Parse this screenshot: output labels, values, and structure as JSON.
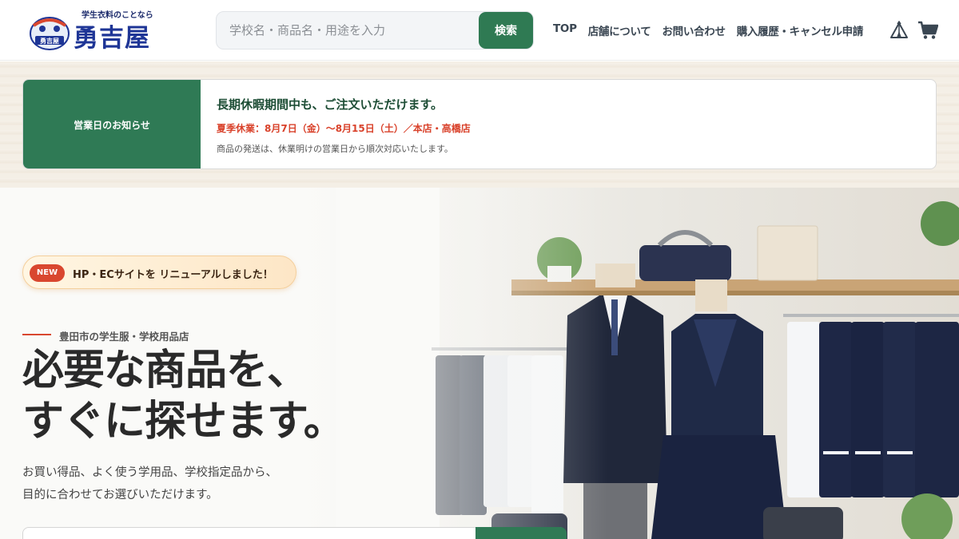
{
  "header": {
    "logo": {
      "tagline": "学生衣料のことなら",
      "name": "勇吉屋",
      "badge_text": "勇吉屋"
    },
    "search": {
      "placeholder": "学校名・商品名・用途を入力",
      "button_label": "検索"
    },
    "nav": [
      {
        "label": "TOP"
      },
      {
        "label": "店舗について"
      },
      {
        "label": "お問い合わせ"
      },
      {
        "label": "購入履歴・キャンセル申請"
      }
    ],
    "icons": [
      "tent-icon",
      "cart-icon"
    ]
  },
  "notice": {
    "label": "営業日のお知らせ",
    "title": "長期休暇期間中も、ご注文いただけます。",
    "holiday": "夏季休業：8月7日（金）〜8月15日（土）／本店・高橋店",
    "sub": "商品の発送は、休業明けの営業日から順次対応いたします。"
  },
  "hero": {
    "new_badge": "NEW",
    "new_text": "HP・ECサイトを リニューアルしました！",
    "eyebrow": "豊田市の学生服・学校用品店",
    "headline_line1": "必要な商品を、",
    "headline_line2": "すぐに探せます。",
    "desc_line1": "お買い得品、よく使う学用品、学校指定品から、",
    "desc_line2": "目的に合わせてお選びいただけます。"
  },
  "colors": {
    "brand_green": "#2f7a55",
    "accent_red": "#d9472f",
    "logo_navy": "#1e3596"
  }
}
